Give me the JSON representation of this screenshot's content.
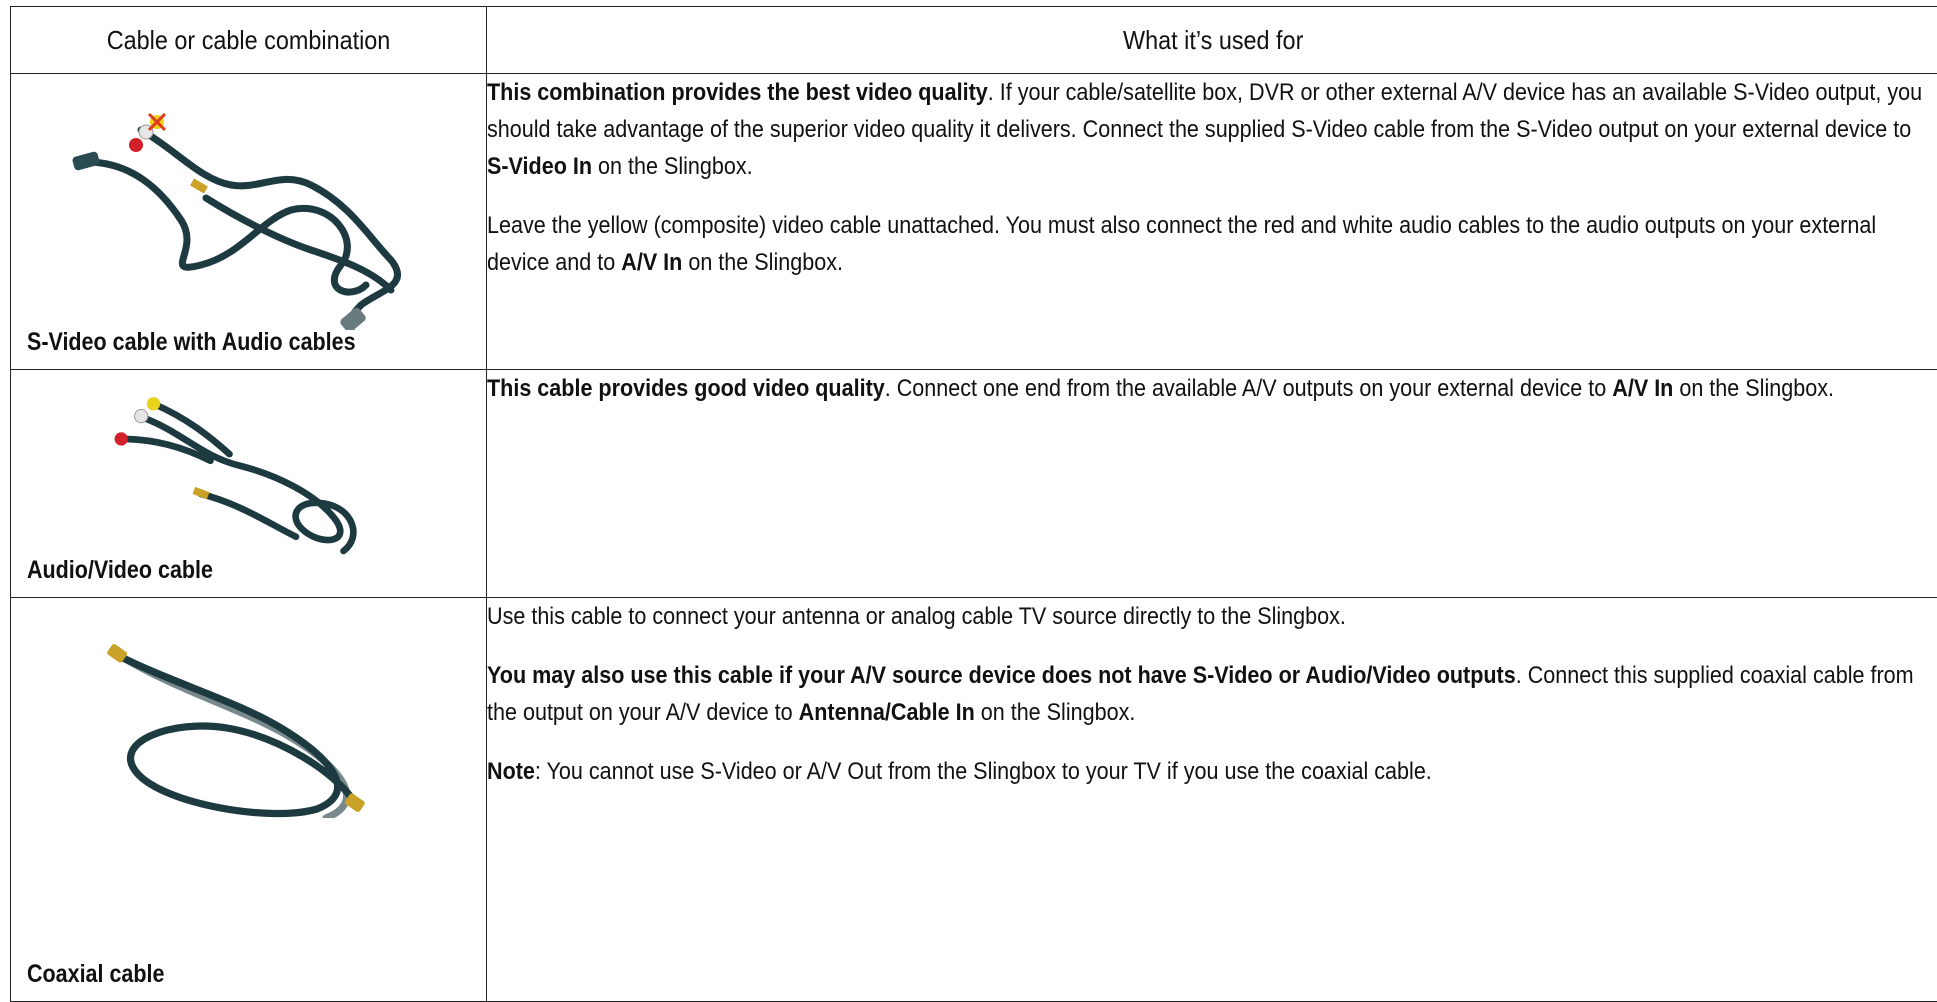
{
  "table": {
    "headers": [
      "Cable or cable combination",
      "What it’s used for"
    ],
    "rows": [
      {
        "caption": "S-Video cable with Audio cables",
        "paragraphs": [
          [
            {
              "b": "This combination provides the best video quality"
            },
            {
              "t": ". If your cable/satellite box, DVR or other external A/V device has an available S-Video output, you should take advantage of the superior video quality it delivers. Connect the supplied S-Video cable from the S-Video output on your external device to "
            },
            {
              "b": "S-Video In"
            },
            {
              "t": " on the Slingbox."
            }
          ],
          [
            {
              "t": "Leave the yellow (composite) video cable unattached. You must also connect the red and white audio cables to the audio outputs on your external device and to "
            },
            {
              "b": "A/V In"
            },
            {
              "t": " on the Slingbox."
            }
          ]
        ]
      },
      {
        "caption": "Audio/Video cable",
        "paragraphs": [
          [
            {
              "b": "This cable provides good video quality"
            },
            {
              "t": ". Connect one end from the available A/V outputs on your external device to "
            },
            {
              "b": "A/V In"
            },
            {
              "t": " on the Slingbox."
            }
          ]
        ]
      },
      {
        "caption": "Coaxial cable",
        "paragraphs": [
          [
            {
              "t": "Use this cable to connect your antenna or analog cable TV source directly to the Slingbox."
            }
          ],
          [
            {
              "b": "You may also use this cable if your A/V source device does not have S-Video or Audio/Video outputs"
            },
            {
              "t": ". Connect this supplied coaxial cable from the output on your A/V device to "
            },
            {
              "b": "Antenna/Cable In"
            },
            {
              "t": " on the Slingbox."
            }
          ],
          [
            {
              "b": "Note"
            },
            {
              "t": ": You cannot use S-Video or A/V Out from the Slingbox to your TV if you use the coaxial cable."
            }
          ]
        ]
      }
    ]
  },
  "colors": {
    "cable": "#1d3a40",
    "red_plug": "#d4202a",
    "yellow_plug": "#e8d21a",
    "white_plug": "#e6e6e6",
    "gold": "#c9a227",
    "cross": "#e03a1e"
  }
}
